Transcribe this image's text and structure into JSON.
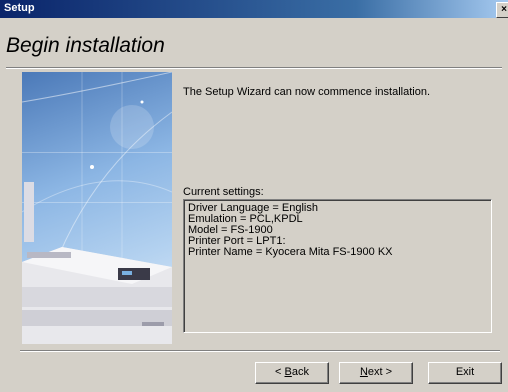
{
  "window": {
    "title": "Setup",
    "close_glyph": "×"
  },
  "page": {
    "heading": "Begin installation",
    "intro": "The Setup Wizard can now commence installation.",
    "settings_label": "Current settings:",
    "settings": [
      "Driver Language = English",
      "Emulation = PCL,KPDL",
      "Model = FS-1900",
      "Printer Port = LPT1:",
      "Printer Name = Kyocera Mita FS-1900 KX"
    ]
  },
  "buttons": {
    "back_mnemonic": "B",
    "back_rest": "ack",
    "back_prefix": "< ",
    "next_mnemonic": "N",
    "next_rest": "ext >",
    "exit": "Exit"
  },
  "artwork": {
    "icon": "printer-artwork"
  }
}
